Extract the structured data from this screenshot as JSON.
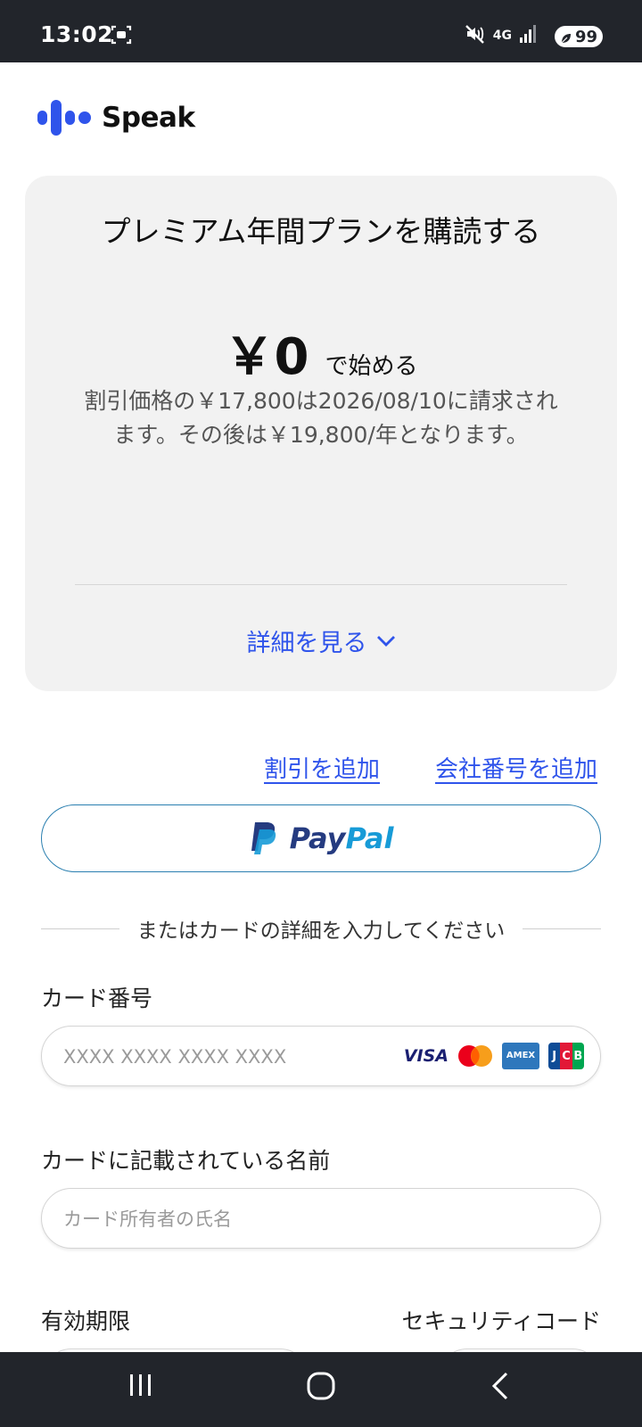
{
  "status_bar": {
    "time": "13:02",
    "network": "4G",
    "battery": "99"
  },
  "brand": {
    "name": "Speak"
  },
  "plan": {
    "title": "プレミアム年間プランを購読する",
    "price": "￥0",
    "price_suffix": "で始める",
    "description": "割引価格の￥17,800は2026/08/10に請求されます。その後は￥19,800/年となります。",
    "details_link": "詳細を見る"
  },
  "links": {
    "add_discount": "割引を追加",
    "add_company_number": "会社番号を追加"
  },
  "paypal": {
    "pay": "Pay",
    "pal": "Pal"
  },
  "or_text": "またはカードの詳細を入力してください",
  "card_number": {
    "label": "カード番号",
    "placeholder": "XXXX XXXX XXXX XXXX",
    "brands": {
      "visa": "VISA",
      "amex": "AMEX",
      "jcb": [
        "J",
        "C",
        "B"
      ]
    }
  },
  "cardholder": {
    "label": "カードに記載されている名前",
    "placeholder": "カード所有者の氏名"
  },
  "expiry": {
    "label": "有効期限"
  },
  "security_code": {
    "label": "セキュリティコード"
  },
  "colors": {
    "accent": "#2f54eb",
    "card_bg": "#f2f2f2",
    "paypal_dark": "#253b80",
    "paypal_light": "#179bd7",
    "system_bar": "#22252b"
  }
}
